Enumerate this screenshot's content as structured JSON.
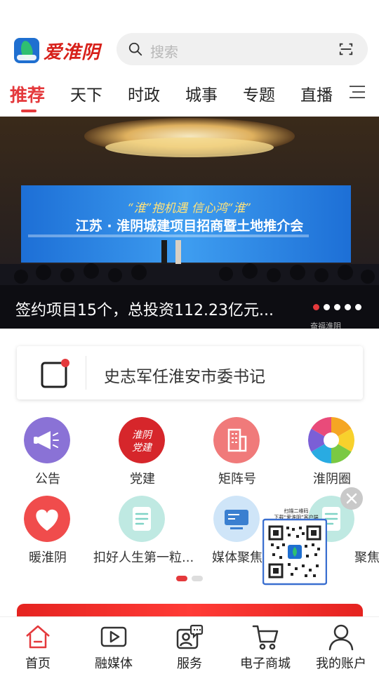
{
  "header": {
    "logo_text": "爱淮阴",
    "search_placeholder": "搜索"
  },
  "tabs": [
    {
      "label": "推荐",
      "active": true
    },
    {
      "label": "天下"
    },
    {
      "label": "时政"
    },
    {
      "label": "城事"
    },
    {
      "label": "专题"
    },
    {
      "label": "直播"
    }
  ],
  "banner": {
    "title": "签约项目15个，总投资112.23亿元...",
    "slogan": "“淮”抱机遇  信心鸿“淮”",
    "screen_title": "江苏 · 淮阴城建项目招商暨土地推介会",
    "watermark": "奋福淮阴",
    "slide_count": 5,
    "active_slide": 1
  },
  "notice": {
    "text": "史志军任淮安市委书记"
  },
  "grid": [
    {
      "label": "公告",
      "icon": "megaphone-icon",
      "color": "#8a72d6"
    },
    {
      "label": "党建",
      "icon": "party-building-icon",
      "badge_text": "淮阴党建",
      "color": "#d6262b"
    },
    {
      "label": "矩阵号",
      "icon": "building-icon",
      "color": "#f07a7a"
    },
    {
      "label": "淮阴圈",
      "icon": "aperture-icon",
      "color": "#f5a623"
    },
    {
      "label": "暖淮阴",
      "icon": "heart-icon",
      "color": "#f04c4c"
    },
    {
      "label": "扣好人生第一粒...",
      "icon": "document-icon",
      "color": "#7fd3c6"
    },
    {
      "label": "媒体聚焦",
      "icon": "monitor-icon",
      "color": "#5aa0e0"
    },
    {
      "label": "聚焦",
      "icon": "document-icon",
      "color": "#7fd3c6"
    }
  ],
  "qr_popup": {
    "caption_line1": "扫描二维码",
    "caption_line2": "下载“爱淮阴”客户端"
  },
  "bottom_nav": [
    {
      "label": "首页",
      "icon": "home-icon",
      "active": true
    },
    {
      "label": "融媒体",
      "icon": "video-icon"
    },
    {
      "label": "服务",
      "icon": "service-chat-icon"
    },
    {
      "label": "电子商城",
      "icon": "cart-icon"
    },
    {
      "label": "我的账户",
      "icon": "user-icon"
    }
  ],
  "colors": {
    "accent": "#e4393c",
    "text": "#222222",
    "muted": "#b8b8b8"
  }
}
